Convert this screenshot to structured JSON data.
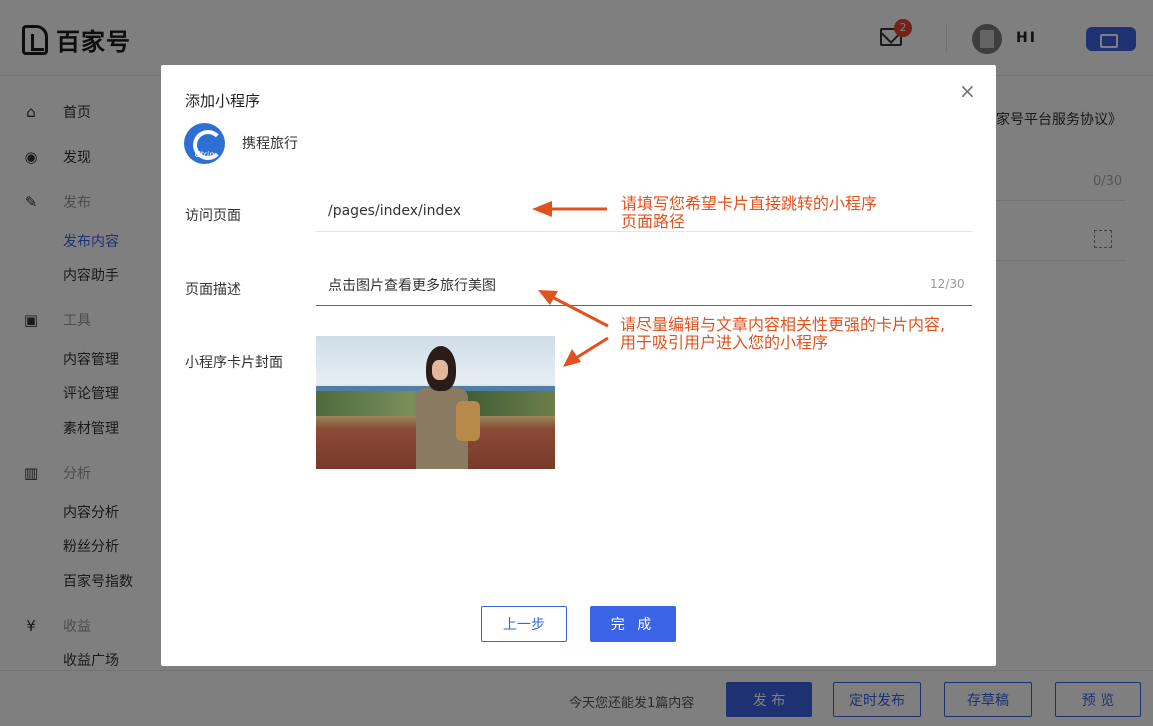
{
  "app": {
    "brand": "百家号"
  },
  "header": {
    "mail_badge": "2",
    "user_name": "HI"
  },
  "sidebar": {
    "items": [
      {
        "icon": "home-icon",
        "label": "首页",
        "type": "item"
      },
      {
        "icon": "eye-icon",
        "label": "发现",
        "type": "item"
      },
      {
        "icon": "edit-icon",
        "label": "发布",
        "type": "group"
      },
      {
        "label": "发布内容",
        "type": "sub-active"
      },
      {
        "label": "内容助手",
        "type": "sub"
      },
      {
        "icon": "clipboard-icon",
        "label": "工具",
        "type": "group"
      },
      {
        "label": "内容管理",
        "type": "sub"
      },
      {
        "label": "评论管理",
        "type": "sub"
      },
      {
        "label": "素材管理",
        "type": "sub"
      },
      {
        "icon": "chart-icon",
        "label": "分析",
        "type": "group"
      },
      {
        "label": "内容分析",
        "type": "sub"
      },
      {
        "label": "粉丝分析",
        "type": "sub"
      },
      {
        "label": "百家号指数",
        "type": "sub"
      },
      {
        "icon": "yen-icon",
        "label": "收益",
        "type": "group"
      },
      {
        "label": "收益广场",
        "type": "sub"
      }
    ]
  },
  "background_right": {
    "agreement_fragment": "家号平台服务协议》",
    "count": "0/30"
  },
  "bottom_bar": {
    "notice": "今天您还能发1篇内容",
    "publish_label": "发 布",
    "schedule_label": "定时发布",
    "draft_label": "存草稿",
    "preview_label": "预 览"
  },
  "modal": {
    "title": "添加小程序",
    "close_symbol": "×",
    "app_logo_text": "Ctrip",
    "app_name": "携程旅行",
    "page_path": {
      "label": "访问页面",
      "value": "/pages/index/index"
    },
    "page_desc": {
      "label": "页面描述",
      "value": "点击图片查看更多旅行美图",
      "count": "12/30"
    },
    "cover": {
      "label": "小程序卡片封面"
    },
    "prev_label": "上一步",
    "done_label": "完 成"
  },
  "annotations": {
    "path_hint": [
      "请填写您希望卡片直接跳转的小程序",
      "页面路径"
    ],
    "desc_hint": [
      "请尽量编辑与文章内容相关性更强的卡片内容,",
      "用于吸引用户进入您的小程序"
    ]
  },
  "colors": {
    "accent": "#3a63e6",
    "annotation": "#e1521e",
    "badge": "#e8432f"
  }
}
